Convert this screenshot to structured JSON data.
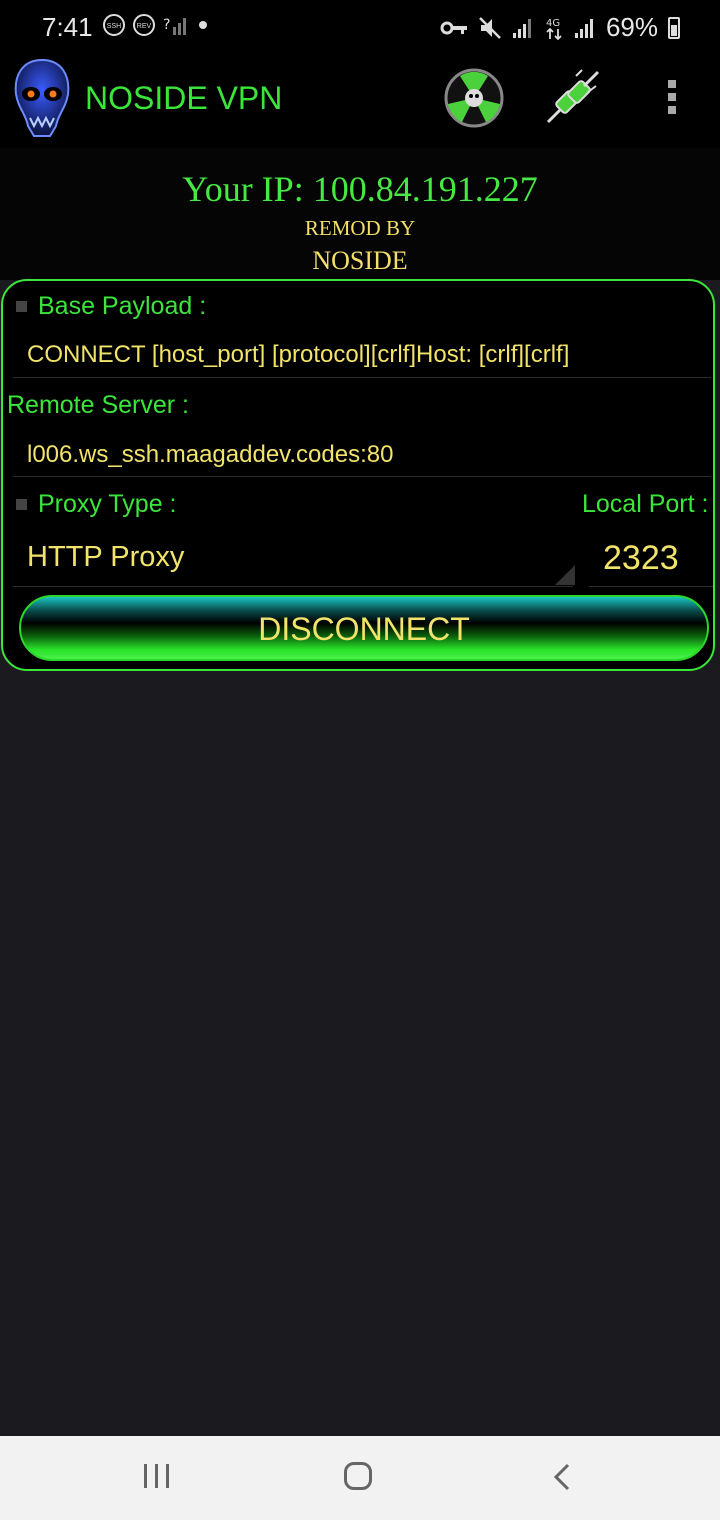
{
  "status_bar": {
    "time": "7:41",
    "notif_icons": [
      "ssh-icon",
      "rev-icon",
      "no-signal-icon"
    ],
    "notif_labels": [
      "SSH",
      "REV"
    ],
    "battery_percent": "69%",
    "right_icons": [
      "vpn-key-icon",
      "mute-icon",
      "signal-icon",
      "4g-icon",
      "signal-icon",
      "battery-icon"
    ]
  },
  "app_bar": {
    "title": "NOSIDE VPN",
    "logo_icon": "skull-logo-icon",
    "actions": [
      "radiation-skull-icon",
      "connection-plug-icon",
      "overflow-menu-icon"
    ]
  },
  "header": {
    "ip_text": "Your IP: 100.84.191.227",
    "remod_text": "REMOD BY",
    "author_text": "NOSIDE"
  },
  "form": {
    "payload_label": "Base Payload :",
    "payload_value": "CONNECT [host_port] [protocol][crlf]Host: [crlf][crlf]",
    "remote_label": "Remote Server :",
    "remote_value": "l006.ws_ssh.maagaddev.codes:80",
    "proxy_label": "Proxy Type :",
    "proxy_value": "HTTP Proxy",
    "port_label": "Local Port :",
    "port_value": "2323",
    "button_label": "DISCONNECT"
  },
  "colors": {
    "accent_green": "#3be63b",
    "value_yellow": "#f2e36a",
    "background": "#1b1b1f"
  },
  "nav": {
    "buttons": [
      "recent-apps-icon",
      "home-icon",
      "back-icon"
    ]
  }
}
